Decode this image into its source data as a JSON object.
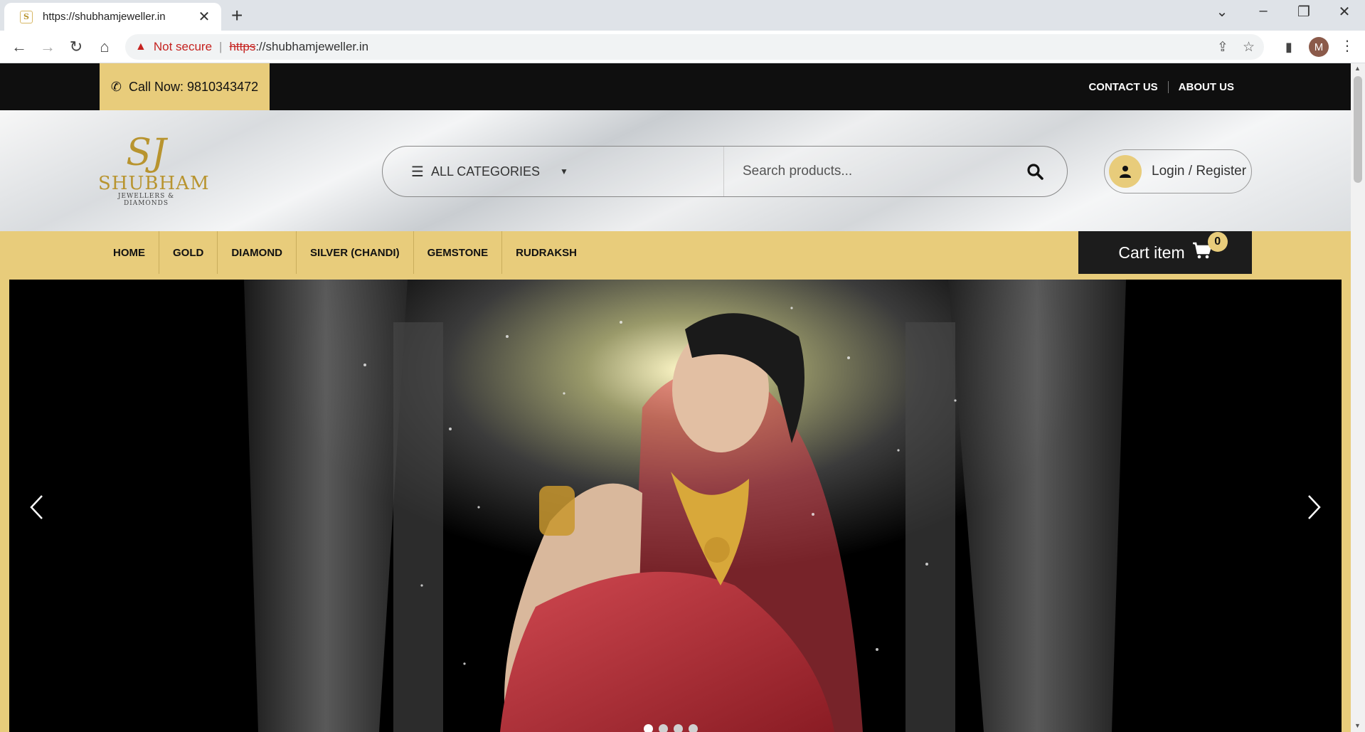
{
  "browser": {
    "tab_title": "https://shubhamjeweller.in",
    "favicon_letter": "S",
    "new_tab_label": "+",
    "security_label": "Not secure",
    "url_scheme": "https",
    "url_rest": "://shubhamjeweller.in",
    "profile_initial": "M"
  },
  "topbar": {
    "call_label": "Call Now:",
    "phone": "9810343472",
    "links": [
      "CONTACT US",
      "ABOUT US"
    ]
  },
  "logo": {
    "mark": "SJ",
    "name": "SHUBHAM",
    "tagline": "JEWELLERS & DIAMONDS"
  },
  "search": {
    "category_label": "ALL CATEGORIES",
    "placeholder": "Search products..."
  },
  "account": {
    "login_label": "Login / Register"
  },
  "nav": {
    "items": [
      "HOME",
      "GOLD",
      "DIAMOND",
      "SILVER (CHANDI)",
      "GEMSTONE",
      "RUDRAKSH"
    ]
  },
  "cart": {
    "label": "Cart item",
    "count": "0"
  },
  "slider": {
    "dot_count": 4,
    "active_slide": 1
  },
  "colors": {
    "accent_gold": "#e8cc7b",
    "topbar_bg": "#0f0f0f",
    "cart_bg": "#1c1c1c"
  }
}
